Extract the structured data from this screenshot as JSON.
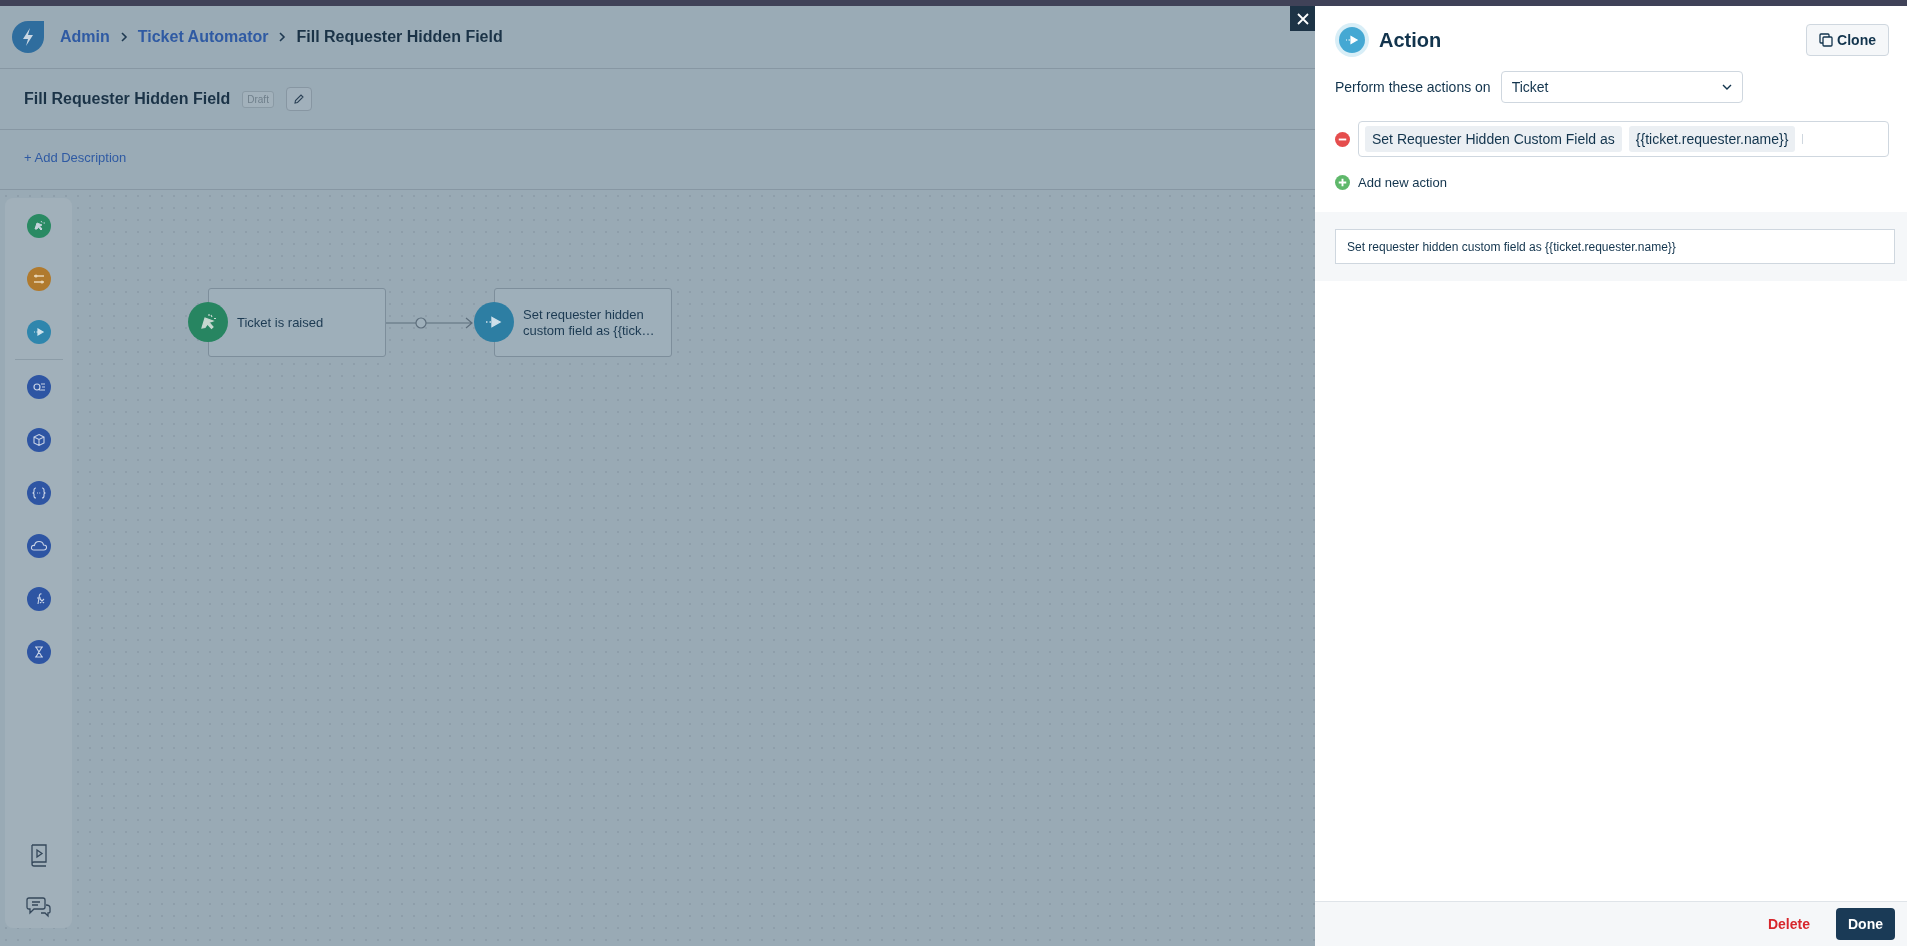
{
  "breadcrumb": [
    {
      "label": "Admin",
      "kind": "link"
    },
    {
      "label": "Ticket Automator",
      "kind": "link"
    },
    {
      "label": "Fill Requester Hidden Field",
      "kind": "current"
    }
  ],
  "workflow": {
    "title": "Fill Requester Hidden Field",
    "status": "Draft",
    "add_description": "+ Add Description"
  },
  "nodes": [
    {
      "kind": "trigger",
      "label": "Ticket is raised"
    },
    {
      "kind": "action",
      "label": "Set requester hidden custom field as {{tick…"
    }
  ],
  "panel": {
    "title": "Action",
    "clone": "Clone",
    "perform_label": "Perform these actions on",
    "perform_on": "Ticket",
    "actions": [
      {
        "field": "Set Requester Hidden Custom Field as",
        "value": "{{ticket.requester.name}}"
      }
    ],
    "add_action": "Add new action",
    "summary": "Set requester hidden custom field as {{ticket.requester.name}}",
    "delete": "Delete",
    "done": "Done"
  }
}
